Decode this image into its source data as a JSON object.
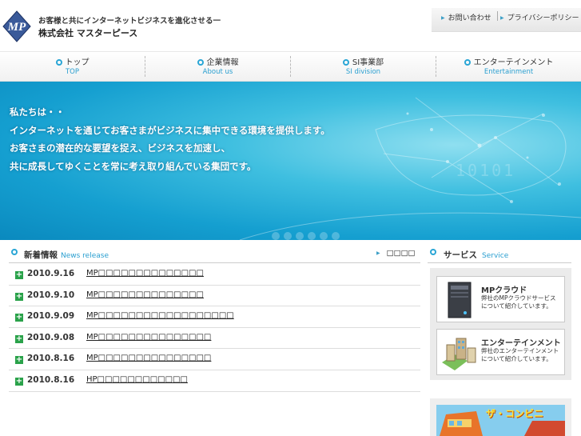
{
  "header": {
    "logo_text": "MP",
    "tagline": "お客様と共にインターネットビジネスを進化させる一",
    "company": "株式会社 マスターピース",
    "util_links": [
      {
        "label": "お問い合わせ"
      },
      {
        "label": "プライバシーポリシー"
      }
    ]
  },
  "nav": [
    {
      "jp": "トップ",
      "en": "TOP"
    },
    {
      "jp": "企業情報",
      "en": "About us"
    },
    {
      "jp": "SI事業部",
      "en": "SI division"
    },
    {
      "jp": "エンターテインメント",
      "en": "Entertainment"
    }
  ],
  "hero": {
    "lines": [
      "私たちは・・",
      "インターネットを通じてお客さまがビジネスに集中できる環境を提供します。",
      "お客さまの潜在的な要望を捉え、ビジネスを加速し、",
      "共に成長してゆくことを常に考え取り組んでいる集団です。"
    ],
    "deco_digits": "10101"
  },
  "news": {
    "title": "新着情報",
    "title_en": "News release",
    "more": "□□□□",
    "items": [
      {
        "date": "2010.9.16",
        "text": "MP□□□□□□□□□□□□□□"
      },
      {
        "date": "2010.9.10",
        "text": "MP□□□□□□□□□□□□□□"
      },
      {
        "date": "2010.9.09",
        "text": "MP□□□□□□□□□□□□□□□□□□"
      },
      {
        "date": "2010.9.08",
        "text": "MP□□□□□□□□□□□□□□□"
      },
      {
        "date": "2010.8.16",
        "text": "MP□□□□□□□□□□□□□□□"
      },
      {
        "date": "2010.8.16",
        "text": "HP□□□□□□□□□□□□"
      }
    ]
  },
  "services": {
    "title": "サービス",
    "title_en": "Service",
    "banners": [
      {
        "title": "MPクラウド",
        "desc1": "弊社のMPクラウドサービス",
        "desc2": "について紹介しています。"
      },
      {
        "title": "エンターテインメント",
        "desc1": "弊社のエンターテインメント",
        "desc2": "について紹介しています。"
      }
    ],
    "promo": "ザ・コンビニ"
  },
  "colors": {
    "accent": "#2aa6d6",
    "hero": "#159fd0",
    "news_plus": "#2aa24a"
  }
}
